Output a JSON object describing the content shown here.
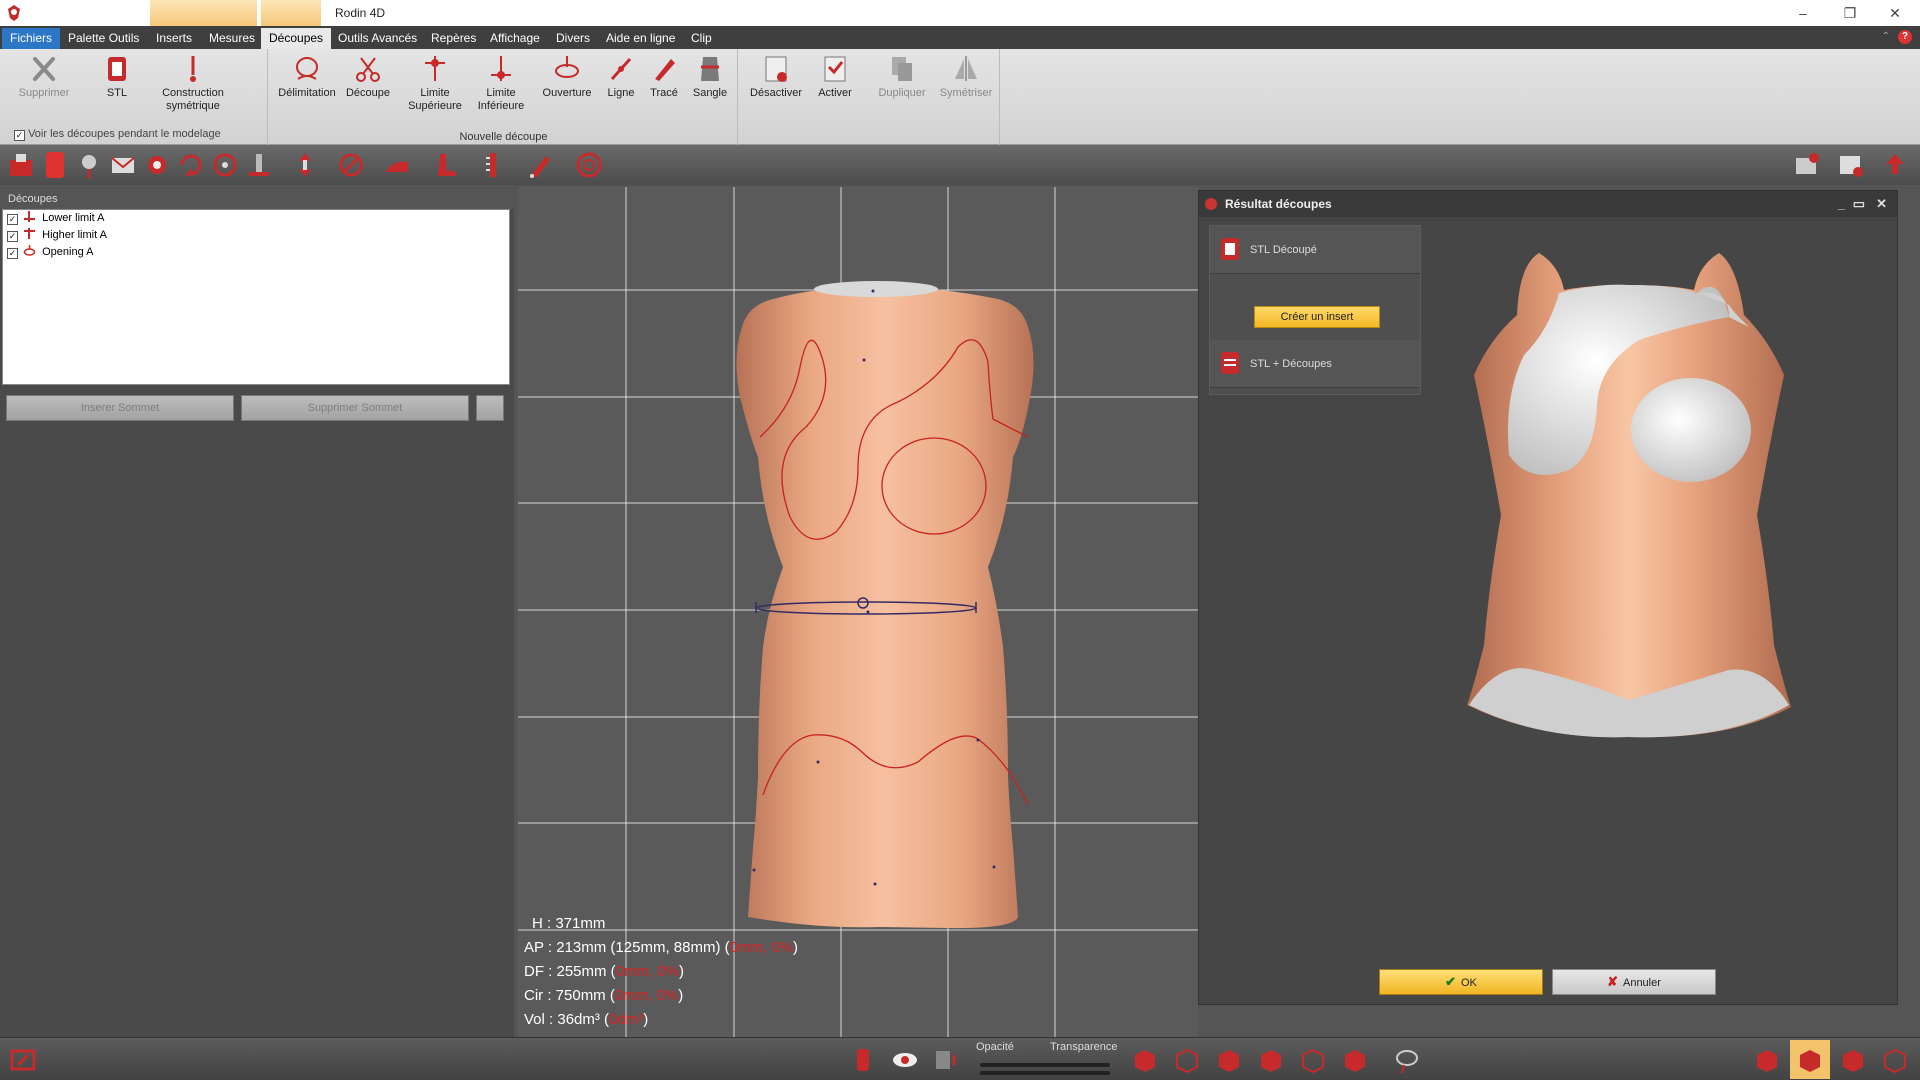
{
  "app": {
    "title": "Rodin 4D"
  },
  "menu": {
    "tabs": [
      {
        "label": "Fichiers"
      },
      {
        "label": "Palette Outils"
      },
      {
        "label": "Inserts"
      },
      {
        "label": "Mesures"
      },
      {
        "label": "Découpes"
      },
      {
        "label": "Outils Avancés"
      },
      {
        "label": "Repères"
      },
      {
        "label": "Affichage"
      },
      {
        "label": "Divers"
      },
      {
        "label": "Aide en ligne"
      },
      {
        "label": "Clip"
      }
    ],
    "active": "Découpes",
    "help_label": "?"
  },
  "ribbon": {
    "group1": {
      "supprimer": "Supprimer",
      "stl": "STL",
      "construction_1": "Construction",
      "construction_2": "symétrique",
      "checkbox_label": "Voir les découpes pendant le modelage"
    },
    "group2": {
      "label": "Nouvelle découpe",
      "delimitation": "Délimitation",
      "decoupe": "Découpe",
      "limite_sup_1": "Limite",
      "limite_sup_2": "Supérieure",
      "limite_inf_1": "Limite",
      "limite_inf_2": "Inférieure",
      "ouverture": "Ouverture",
      "ligne": "Ligne",
      "trace": "Tracé",
      "sangle": "Sangle"
    },
    "group3": {
      "desactiver": "Désactiver",
      "activer": "Activer",
      "dupliquer": "Dupliquer",
      "symetriser": "Symétriser"
    }
  },
  "left_panel": {
    "header": "Découpes",
    "items": [
      {
        "label": "Lower limit A",
        "checked": true
      },
      {
        "label": "Higher limit A",
        "checked": true
      },
      {
        "label": "Opening A",
        "checked": true
      }
    ],
    "insert_vertex": "Inserer Sommet",
    "delete_vertex": "Supprimer Sommet"
  },
  "measurements": {
    "h": "H : 371mm",
    "ap_main": "AP : 213mm (125mm, 88mm) (",
    "ap_red": "0mm, 0%",
    "df_main": "DF : 255mm (",
    "df_red": "0mm, 0%",
    "cir_main": "Cir : 750mm (",
    "cir_red": "0mm, 0%",
    "vol_main": "Vol : 36dm³ (",
    "vol_red": "0dm³",
    "close": ")"
  },
  "dialog": {
    "title": "Résultat découpes",
    "options": {
      "stl_decoupe": "STL Découpé",
      "creer_insert": "Créer un insert",
      "stl_decoupes": "STL + Découpes"
    },
    "ok": "OK",
    "cancel": "Annuler"
  },
  "statusbar": {
    "opacity_label": "Opacité",
    "transparency_label": "Transparence"
  },
  "colors": {
    "skin": "#e9a883",
    "cut_line": "#c62222",
    "accent_blue": "#2b76c5",
    "button_yellow": "#f4b824"
  }
}
